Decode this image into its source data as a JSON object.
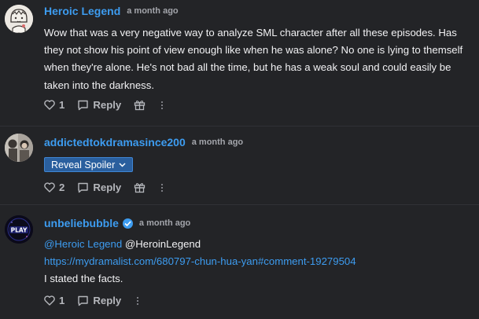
{
  "comments": [
    {
      "username": "Heroic Legend",
      "time": "a month ago",
      "text": "Wow that was a very negative way to analyze SML character after all these episodes. Has they not show his point of view enough like when he was alone? No one is lying to themself when they're alone. He's not bad all the time, but he has a weak soul and could easily be taken into the darkness.",
      "likes": "1",
      "reply_label": "Reply"
    },
    {
      "username": "addictedtokdramasince200",
      "time": "a month ago",
      "spoiler_label": "Reveal Spoiler",
      "likes": "2",
      "reply_label": "Reply"
    },
    {
      "username": "unbeliebubble",
      "time": "a month ago",
      "mention": "@Heroic Legend",
      "mention_handle": "@HeroinLegend",
      "link": "https://mydramalist.com/680797-chun-hua-yan#comment-19279504",
      "text": "I stated the facts.",
      "likes": "1",
      "reply_label": "Reply",
      "avatar_text": "PLAY"
    }
  ],
  "colors": {
    "background": "#232427",
    "username": "#3d9cf0",
    "spoiler_bg": "#2a5f9e"
  },
  "icons": [
    "heart-icon",
    "comment-icon",
    "gift-icon",
    "more-icon",
    "verified-icon",
    "chevron-down-icon"
  ]
}
